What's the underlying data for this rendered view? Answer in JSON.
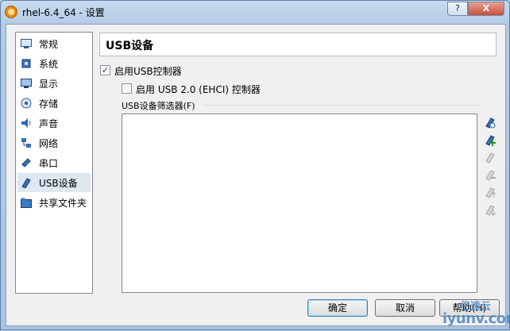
{
  "window": {
    "title": "rhel-6.4_64 - 设置",
    "help_label": "?",
    "close_label": "X"
  },
  "sidebar": {
    "items": [
      {
        "label": "常规",
        "icon": "general-icon"
      },
      {
        "label": "系统",
        "icon": "system-chip-icon"
      },
      {
        "label": "显示",
        "icon": "monitor-icon"
      },
      {
        "label": "存储",
        "icon": "storage-disk-icon"
      },
      {
        "label": "声音",
        "icon": "speaker-icon"
      },
      {
        "label": "网络",
        "icon": "network-icon"
      },
      {
        "label": "串口",
        "icon": "serial-port-icon"
      },
      {
        "label": "USB设备",
        "icon": "usb-plug-icon",
        "selected": true
      },
      {
        "label": "共享文件夹",
        "icon": "shared-folder-icon"
      }
    ]
  },
  "main": {
    "title": "USB设备",
    "enable_usb_label": "启用USB控制器",
    "enable_usb_checked": true,
    "enable_ehci_label": "启用 USB 2.0 (EHCI) 控制器",
    "enable_ehci_checked": false,
    "filters_label": "USB设备筛选器(F)",
    "filter_tools": [
      "add-filter-icon",
      "add-from-device-icon",
      "edit-filter-icon",
      "remove-filter-icon",
      "move-up-icon",
      "move-down-icon"
    ]
  },
  "buttons": {
    "ok": "确定",
    "cancel": "取消",
    "help": "帮助(H)"
  },
  "watermark": {
    "text": "亿速云",
    "url_text": "iyunv.com"
  },
  "colors": {
    "selection": "#dfe7f3",
    "titlebar": "#b9d1ea",
    "accent": "#1c5aa6"
  }
}
